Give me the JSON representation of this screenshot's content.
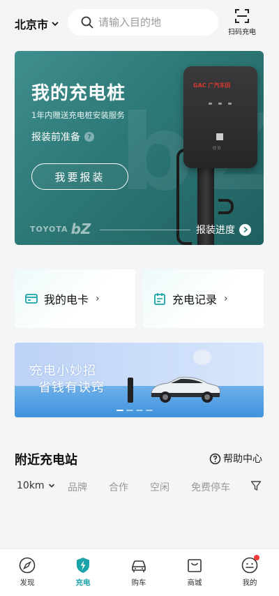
{
  "header": {
    "city": "北京市",
    "search_placeholder": "请输入目的地",
    "scan_label": "扫码充电"
  },
  "hero": {
    "title": "我的充电桩",
    "subtitle": "1年内赠送充电桩安装服务",
    "prep_label": "报装前准备",
    "help_mark": "?",
    "button_label": "我要报装",
    "progress_label": "报装进度",
    "brand_text": "TOYOTA",
    "model_text": "bZ",
    "charger_brand": "GAC 广汽丰田"
  },
  "cards": [
    {
      "label": "我的电卡",
      "icon": "card-icon"
    },
    {
      "label": "充电记录",
      "icon": "calendar-icon"
    }
  ],
  "promo": {
    "line1": "充电小妙招",
    "line2": "省钱有诀窍",
    "slide_count": 4,
    "active_slide": 1
  },
  "nearby": {
    "title": "附近充电站",
    "help_label": "帮助中心",
    "filters": {
      "distance": "10km",
      "brand": "品牌",
      "partner": "合作",
      "idle": "空闲",
      "free_parking": "免费停车"
    }
  },
  "tabbar": {
    "items": [
      {
        "label": "发现",
        "icon": "compass-icon",
        "active": false
      },
      {
        "label": "充电",
        "icon": "charge-icon",
        "active": true
      },
      {
        "label": "购车",
        "icon": "car-icon",
        "active": false
      },
      {
        "label": "商城",
        "icon": "bag-icon",
        "active": false
      },
      {
        "label": "我的",
        "icon": "profile-icon",
        "active": false,
        "badge": true
      }
    ]
  },
  "colors": {
    "accent": "#1aa3a8",
    "hero_bg": "#2e7a78",
    "badge": "#f03a3a"
  }
}
